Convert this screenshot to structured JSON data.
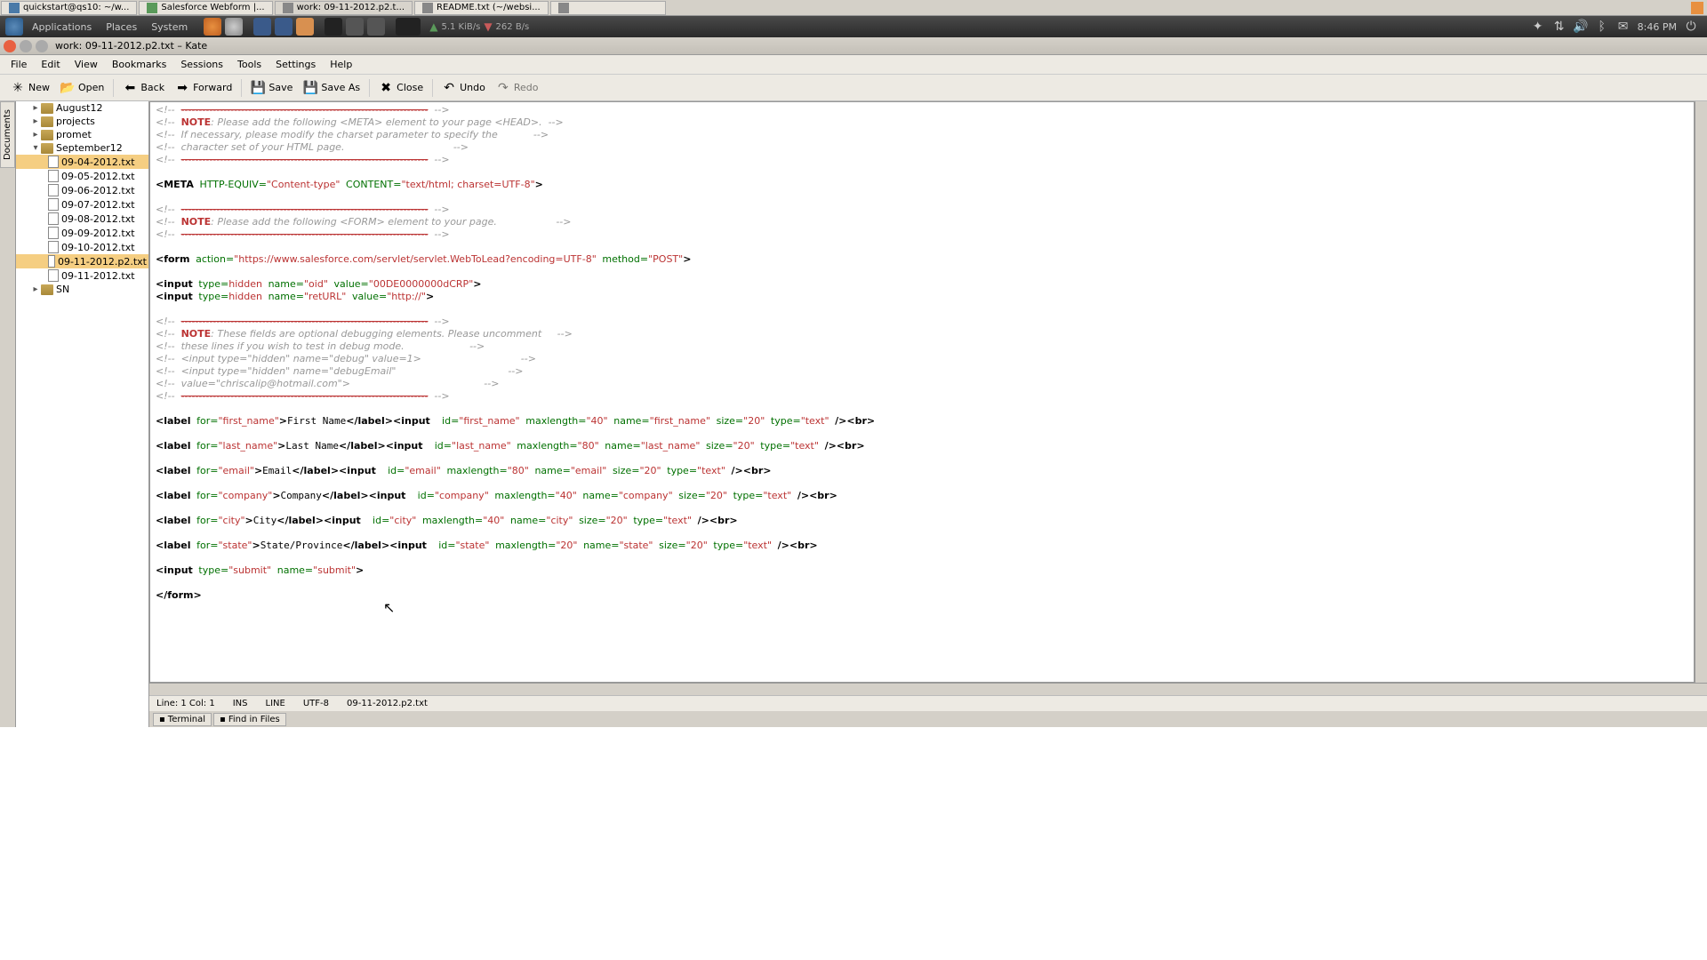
{
  "taskbar_items": [
    {
      "icon": "term",
      "label": "quickstart@qs10: ~/w..."
    },
    {
      "icon": "chrome",
      "label": "Salesforce Webform |..."
    },
    {
      "icon": "kate",
      "label": "work: 09-11-2012.p2.t...",
      "active": true
    },
    {
      "icon": "kate",
      "label": "README.txt (~/websi..."
    },
    {
      "icon": "misc",
      "label": ""
    }
  ],
  "gnome": {
    "menus": [
      "Applications",
      "Places",
      "System"
    ],
    "net_up": "5.1 KiB/s",
    "net_down": "262 B/s",
    "time": "8:46 PM"
  },
  "window_title": "work: 09-11-2012.p2.txt – Kate",
  "menubar": [
    "File",
    "Edit",
    "View",
    "Bookmarks",
    "Sessions",
    "Tools",
    "Settings",
    "Help"
  ],
  "toolbar": [
    {
      "id": "new",
      "label": "New",
      "icon": "✳"
    },
    {
      "id": "open",
      "label": "Open",
      "icon": "📂"
    },
    {
      "sep": true
    },
    {
      "id": "back",
      "label": "Back",
      "icon": "⬅"
    },
    {
      "id": "forward",
      "label": "Forward",
      "icon": "➡"
    },
    {
      "sep": true
    },
    {
      "id": "save",
      "label": "Save",
      "icon": "💾"
    },
    {
      "id": "saveas",
      "label": "Save As",
      "icon": "💾"
    },
    {
      "sep": true
    },
    {
      "id": "close",
      "label": "Close",
      "icon": "✖"
    },
    {
      "sep": true
    },
    {
      "id": "undo",
      "label": "Undo",
      "icon": "↶"
    },
    {
      "id": "redo",
      "label": "Redo",
      "icon": "↷",
      "disabled": true
    }
  ],
  "side_tab": "Documents",
  "tree": {
    "folders_top": [
      "August12",
      "projects",
      "promet"
    ],
    "folder_open": "September12",
    "files": [
      "09-04-2012.txt",
      "09-05-2012.txt",
      "09-06-2012.txt",
      "09-07-2012.txt",
      "09-08-2012.txt",
      "09-09-2012.txt",
      "09-10-2012.txt",
      "09-11-2012.p2.txt",
      "09-11-2012.txt"
    ],
    "selected_a": "09-04-2012.txt",
    "selected_b": "09-11-2012.p2.txt",
    "folder_after": "SN"
  },
  "code": {
    "dash": "----------------------------------------------------------------------",
    "note": "NOTE",
    "c1": ": Please add the following <META> element to your page <HEAD>.",
    "c2": "If necessary, please modify the charset parameter to specify the",
    "c3": "character set of your HTML page.",
    "meta_tag": "<META",
    "meta_a1": "HTTP-EQUIV=",
    "meta_v1": "\"Content-type\"",
    "meta_a2": "CONTENT=",
    "meta_v2": "\"text/html; charset=UTF-8\"",
    "close_angle": ">",
    "c5": ": Please add the following <FORM> element to your page.",
    "form_tag": "<form",
    "form_a1": "action=",
    "form_v1": "\"https://www.salesforce.com/servlet/servlet.WebToLead?encoding=UTF-8\"",
    "form_a2": "method=",
    "form_v2": "\"POST\"",
    "input_tag": "<input",
    "type_attr": "type=",
    "hidden_val": "hidden",
    "name_attr": "name=",
    "value_attr": "value=",
    "oid_name": "\"oid\"",
    "oid_val": "\"00DE0000000dCRP\"",
    "ret_name": "\"retURL\"",
    "ret_val": "\"http://\"",
    "c6": ": These fields are optional debugging elements. Please uncomment",
    "c7": "these lines if you wish to test in debug mode.",
    "c8": "<input type=\"hidden\" name=\"debug\" value=1>",
    "c9": "<input type=\"hidden\" name=\"debugEmail\"",
    "c10": "value=\"chriscalip@hotmail.com\">",
    "label_tag": "<label",
    "label_close": "</label>",
    "for_attr": "for=",
    "id_attr": "id=",
    "maxlen_attr": "maxlength=",
    "size_attr": "size=",
    "br_tag": "<br>",
    "slash_close": "/>",
    "fields": [
      {
        "for": "\"first_name\"",
        "text": "First Name",
        "id": "\"first_name\"",
        "max": "\"40\"",
        "name": "\"first_name\"",
        "size": "\"20\"",
        "type": "\"text\""
      },
      {
        "for": "\"last_name\"",
        "text": "Last Name",
        "id": "\"last_name\"",
        "max": "\"80\"",
        "name": "\"last_name\"",
        "size": "\"20\"",
        "type": "\"text\""
      },
      {
        "for": "\"email\"",
        "text": "Email",
        "id": "\"email\"",
        "max": "\"80\"",
        "name": "\"email\"",
        "size": "\"20\"",
        "type": "\"text\""
      },
      {
        "for": "\"company\"",
        "text": "Company",
        "id": "\"company\"",
        "max": "\"40\"",
        "name": "\"company\"",
        "size": "\"20\"",
        "type": "\"text\""
      },
      {
        "for": "\"city\"",
        "text": "City",
        "id": "\"city\"",
        "max": "\"40\"",
        "name": "\"city\"",
        "size": "\"20\"",
        "type": "\"text\""
      },
      {
        "for": "\"state\"",
        "text": "State/Province",
        "id": "\"state\"",
        "max": "\"20\"",
        "name": "\"state\"",
        "size": "\"20\"",
        "type": "\"text\""
      }
    ],
    "submit_type": "\"submit\"",
    "submit_name": "\"submit\"",
    "form_close": "</form>"
  },
  "status": {
    "pos": "Line: 1 Col: 1",
    "ins": "INS",
    "mode": "LINE",
    "enc": "UTF-8",
    "file": "09-11-2012.p2.txt"
  },
  "bottom_tabs": [
    "Terminal",
    "Find in Files"
  ]
}
